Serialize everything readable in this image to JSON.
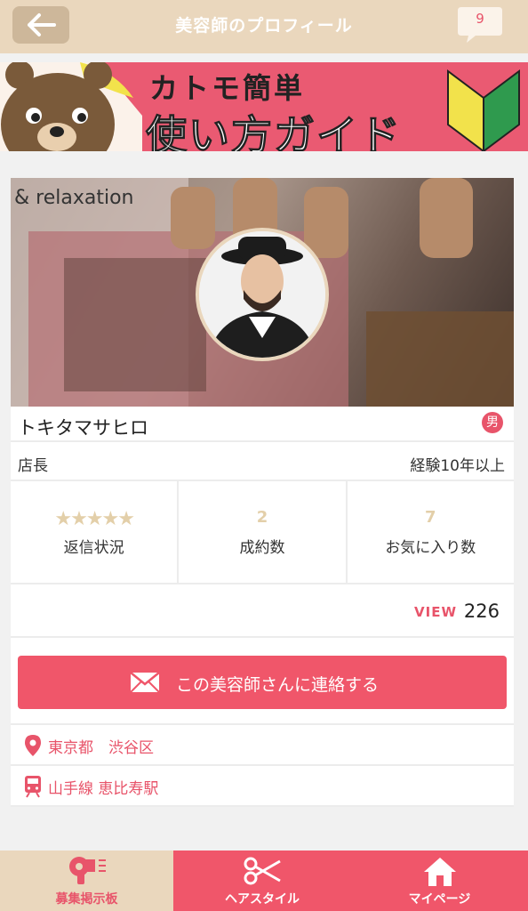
{
  "header": {
    "title": "美容師のプロフィール",
    "notification_count": "9"
  },
  "banner": {
    "line1": "カトモ簡単",
    "line2": "使い方ガイド"
  },
  "profile": {
    "cover_tag": "& relaxation",
    "name": "トキタマサヒロ",
    "gender": "男",
    "role": "店長",
    "experience": "経験10年以上",
    "stats": [
      {
        "value": "★★★★★",
        "label": "返信状況",
        "rating": 5
      },
      {
        "value": "2",
        "label": "成約数"
      },
      {
        "value": "7",
        "label": "お気に入り数"
      }
    ],
    "view_label": "VIEW",
    "view_count": "226"
  },
  "contact": {
    "button_label": "この美容師さんに連絡する"
  },
  "info": {
    "location": "東京都　渋谷区",
    "station": "山手線 恵比寿駅"
  },
  "tabbar": {
    "items": [
      {
        "label": "募集掲示板",
        "icon": "hair-dryer-icon"
      },
      {
        "label": "ヘアスタイル",
        "icon": "scissors-icon"
      },
      {
        "label": "マイページ",
        "icon": "home-icon"
      }
    ]
  },
  "colors": {
    "accent": "#f0566a",
    "beige": "#ead7bd",
    "star": "#e3cfa9"
  }
}
